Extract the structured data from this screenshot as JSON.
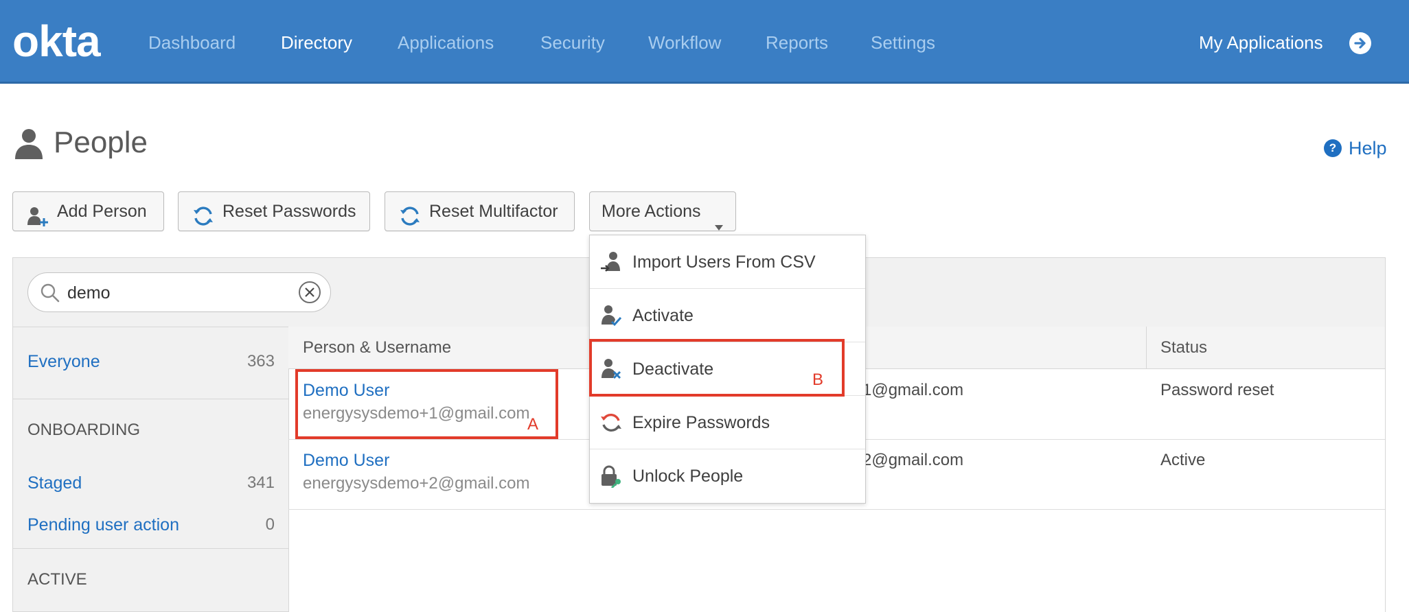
{
  "brand": {
    "logo": "okta",
    "accent": "#3a7ec4",
    "link_color": "#1f6fc1",
    "annotation_color": "#e23b2a"
  },
  "nav": {
    "items": [
      {
        "label": "Dashboard",
        "active": false
      },
      {
        "label": "Directory",
        "active": true
      },
      {
        "label": "Applications",
        "active": false
      },
      {
        "label": "Security",
        "active": false
      },
      {
        "label": "Workflow",
        "active": false
      },
      {
        "label": "Reports",
        "active": false
      },
      {
        "label": "Settings",
        "active": false
      }
    ],
    "my_applications": "My Applications",
    "my_applications_icon": "arrow-right-circle-icon"
  },
  "page": {
    "title": "People",
    "title_icon": "person-icon",
    "help": "Help",
    "help_icon": "question-circle-icon"
  },
  "toolbar": {
    "add_person": "Add Person",
    "reset_passwords": "Reset Passwords",
    "reset_multifactor": "Reset Multifactor",
    "more_actions": "More Actions"
  },
  "more_actions_menu": {
    "items": [
      {
        "label": "Import Users From CSV",
        "icon": "import-user-icon"
      },
      {
        "label": "Activate",
        "icon": "activate-user-icon"
      },
      {
        "label": "Deactivate",
        "icon": "deactivate-user-icon"
      },
      {
        "label": "Expire Passwords",
        "icon": "refresh-icon"
      },
      {
        "label": "Unlock People",
        "icon": "unlock-icon"
      }
    ]
  },
  "search": {
    "value": "demo",
    "icon": "search-icon",
    "clear_icon": "clear-icon"
  },
  "sidebar": {
    "everyone": {
      "label": "Everyone",
      "count": "363"
    },
    "sections": [
      {
        "heading": "ONBOARDING",
        "items": [
          {
            "label": "Staged",
            "count": "341"
          },
          {
            "label": "Pending user action",
            "count": "0"
          }
        ]
      },
      {
        "heading": "ACTIVE",
        "items": []
      }
    ]
  },
  "table": {
    "columns": [
      "Person & Username",
      "Status"
    ],
    "rows": [
      {
        "name": "Demo User",
        "username": "energysysdemo+1@gmail.com",
        "email_visible": "1@gmail.com",
        "status": "Password reset"
      },
      {
        "name": "Demo User",
        "username": "energysysdemo+2@gmail.com",
        "email_visible": "2@gmail.com",
        "status": "Active"
      }
    ]
  },
  "annotations": {
    "a": "A",
    "b": "B"
  }
}
